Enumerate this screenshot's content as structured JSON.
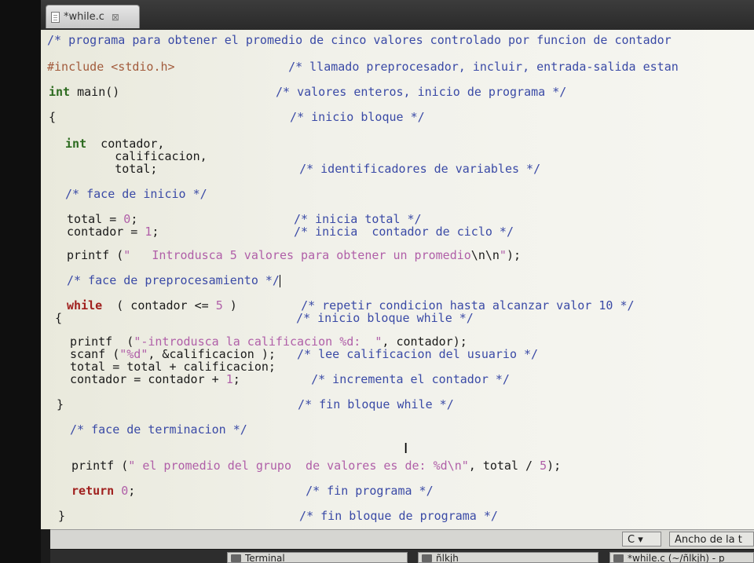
{
  "tab": {
    "title": "*while.c",
    "close": "⊠"
  },
  "code": [
    {
      "parts": [
        {
          "c": "cm",
          "t": "/* programa para obtener el promedio de cinco valores controlado por funcion de contador"
        }
      ]
    },
    {
      "parts": [
        {
          "c": "pp",
          "t": "#include <stdio.h>"
        },
        {
          "c": "",
          "t": "                "
        },
        {
          "c": "cm",
          "t": "/* llamado preprocesador, incluir, entrada-salida estan"
        }
      ]
    },
    {
      "parts": [
        {
          "c": "ty",
          "t": "int"
        },
        {
          "c": "",
          "t": " main()"
        },
        {
          "c": "",
          "t": "                      "
        },
        {
          "c": "cm",
          "t": "/* valores enteros, inicio de programa */"
        }
      ]
    },
    {
      "parts": [
        {
          "c": "",
          "t": "{"
        },
        {
          "c": "",
          "t": "                                 "
        },
        {
          "c": "cm",
          "t": "/* inicio bloque */"
        }
      ]
    },
    {
      "parts": [
        {
          "c": "ty",
          "t": " int"
        },
        {
          "c": "",
          "t": "  contador,"
        }
      ]
    },
    {
      "parts": [
        {
          "c": "",
          "t": "        calificacion,"
        }
      ]
    },
    {
      "parts": [
        {
          "c": "",
          "t": "        total;"
        },
        {
          "c": "",
          "t": "                    "
        },
        {
          "c": "cm",
          "t": "/* identificadores de variables */"
        }
      ]
    },
    {
      "parts": [
        {
          "c": "cm",
          "t": " /* face de inicio */"
        }
      ]
    },
    {
      "parts": [
        {
          "c": "",
          "t": " total = "
        },
        {
          "c": "nu",
          "t": "0"
        },
        {
          "c": "",
          "t": ";"
        },
        {
          "c": "",
          "t": "                      "
        },
        {
          "c": "cm",
          "t": "/* inicia total */"
        }
      ]
    },
    {
      "parts": [
        {
          "c": "",
          "t": " contador = "
        },
        {
          "c": "nu",
          "t": "1"
        },
        {
          "c": "",
          "t": ";"
        },
        {
          "c": "",
          "t": "                   "
        },
        {
          "c": "cm",
          "t": "/* inicia  contador de ciclo */"
        }
      ]
    },
    {
      "parts": [
        {
          "c": "",
          "t": " printf ("
        },
        {
          "c": "st",
          "t": "\"   Introdusca 5 valores para obtener un promedio"
        },
        {
          "c": "",
          "t": "\\n\\n"
        },
        {
          "c": "st",
          "t": "\""
        },
        {
          "c": "",
          "t": ");"
        }
      ]
    },
    {
      "parts": [
        {
          "c": "cm",
          "t": " /* face de preprocesamiento */"
        }
      ],
      "cursor": true
    },
    {
      "parts": [
        {
          "c": "kw",
          "t": " while"
        },
        {
          "c": "",
          "t": "  ( contador <= "
        },
        {
          "c": "nu",
          "t": "5"
        },
        {
          "c": "",
          "t": " )"
        },
        {
          "c": "",
          "t": "         "
        },
        {
          "c": "cm",
          "t": "/* repetir condicion hasta alcanzar valor 10 */"
        }
      ]
    },
    {
      "parts": [
        {
          "c": "",
          "t": "{"
        },
        {
          "c": "",
          "t": "                                 "
        },
        {
          "c": "cm",
          "t": "/* inicio bloque while */"
        }
      ]
    },
    {
      "parts": [
        {
          "c": "",
          "t": " printf  ("
        },
        {
          "c": "st",
          "t": "\"-introdusca la calificacion %d:  \""
        },
        {
          "c": "",
          "t": ", contador);"
        }
      ]
    },
    {
      "parts": [
        {
          "c": "",
          "t": " scanf ("
        },
        {
          "c": "st",
          "t": "\"%d\""
        },
        {
          "c": "",
          "t": ", &calificacion );"
        },
        {
          "c": "",
          "t": "   "
        },
        {
          "c": "cm",
          "t": "/* lee calificacion del usuario */"
        }
      ]
    },
    {
      "parts": [
        {
          "c": "",
          "t": " total = total + calificacion;"
        }
      ]
    },
    {
      "parts": [
        {
          "c": "",
          "t": " contador = contador + "
        },
        {
          "c": "nu",
          "t": "1"
        },
        {
          "c": "",
          "t": ";"
        },
        {
          "c": "",
          "t": "          "
        },
        {
          "c": "cm",
          "t": "/* incrementa el contador */"
        }
      ]
    },
    {
      "parts": [
        {
          "c": "",
          "t": "}"
        },
        {
          "c": "",
          "t": "                                 "
        },
        {
          "c": "cm",
          "t": "/* fin bloque while */"
        }
      ]
    },
    {
      "parts": [
        {
          "c": "cm",
          "t": " /* face de terminacion */"
        }
      ]
    },
    {
      "parts": [
        {
          "c": "",
          "t": " printf ("
        },
        {
          "c": "st",
          "t": "\" el promedio del grupo  de valores es de: %d\\n\""
        },
        {
          "c": "",
          "t": ", total / "
        },
        {
          "c": "nu",
          "t": "5"
        },
        {
          "c": "",
          "t": ");"
        }
      ]
    },
    {
      "parts": [
        {
          "c": "kw",
          "t": " return"
        },
        {
          "c": "",
          "t": " "
        },
        {
          "c": "nu",
          "t": "0"
        },
        {
          "c": "",
          "t": ";"
        },
        {
          "c": "",
          "t": "                        "
        },
        {
          "c": "cm",
          "t": "/* fin programa */"
        }
      ]
    },
    {
      "parts": [
        {
          "c": "",
          "t": "}"
        },
        {
          "c": "",
          "t": "                                 "
        },
        {
          "c": "cm",
          "t": "/* fin bloque de programa */"
        }
      ]
    }
  ],
  "status": {
    "language": "C ▾",
    "tab_width": "Ancho de la t"
  },
  "taskbar": {
    "terminal": "Terminal",
    "files": "ñlkjh",
    "editor": "*while.c (~/ñlkjh) - p"
  },
  "colors": {
    "comment": "#3a4aa6",
    "keyword": "#a0201e",
    "type": "#2b6a1e",
    "string": "#b05fa8",
    "preprocessor": "#a25b3c"
  }
}
